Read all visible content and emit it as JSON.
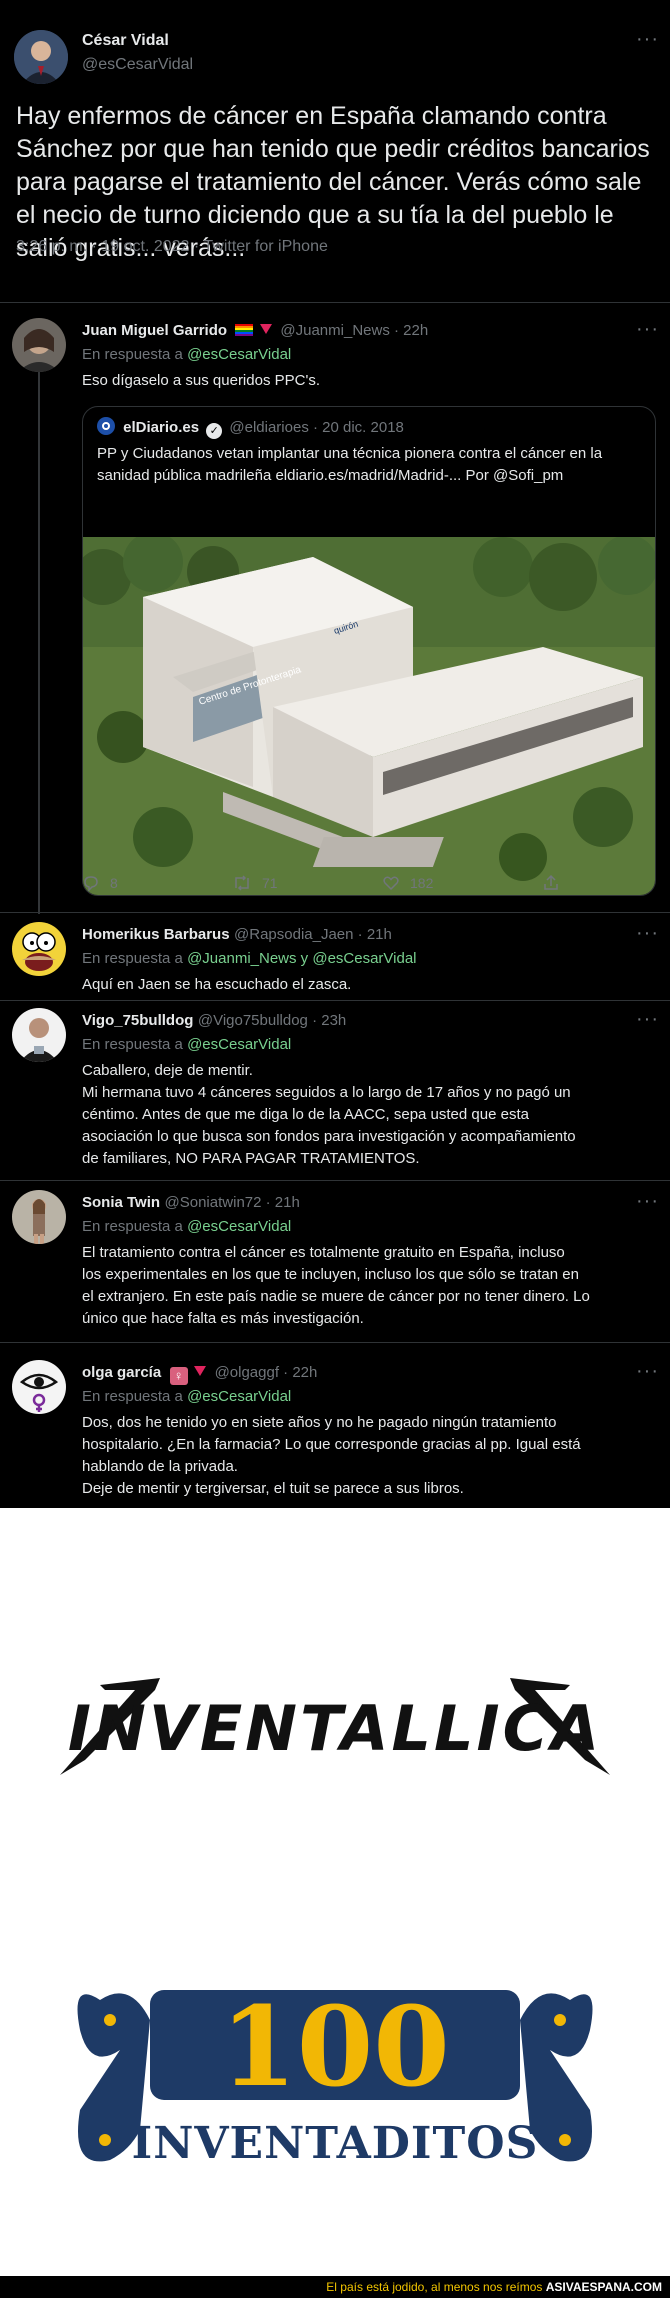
{
  "main_tweet": {
    "name": "César Vidal",
    "handle": "@esCesarVidal",
    "text": "Hay enfermos de cáncer en España clamando contra Sánchez por que han tenido que pedir créditos bancarios para pagarse el tratamiento del cáncer. Verás cómo sale el necio de turno diciendo que a su tía la del pueblo le salió gratis... verás...",
    "meta": "3:26 p. m. · 19 oct. 2022 · Twitter for iPhone"
  },
  "replies": [
    {
      "name": "Juan Miguel Garrido",
      "handle": "@Juanmi_News · 22h",
      "replying_prefix": "En respuesta a",
      "replying_to": "@esCesarVidal",
      "text": "Eso dígaselo a sus queridos PPC's.",
      "quote": {
        "author": "elDiario.es",
        "author_handle": "@eldiarioes · 20 dic. 2018",
        "text": "PP y Ciudadanos vetan implantar una técnica pionera contra el cáncer en la sanidad pública madrileña eldiario.es/madrid/Madrid-... Por @Sofi_pm",
        "image_sign_left": "Centro de Protonterapia",
        "image_sign_right": "quirón"
      },
      "actions": {
        "replies": "8",
        "retweets": "71",
        "likes": "182"
      }
    },
    {
      "name": "Homerikus Barbarus",
      "handle": "@Rapsodia_Jaen · 21h",
      "replying_prefix": "En respuesta a",
      "replying_to": "@Juanmi_News y @esCesarVidal",
      "text": "Aquí en Jaen se ha escuchado el zasca."
    },
    {
      "name": "Vigo_75bulldog",
      "handle": "@Vigo75bulldog · 23h",
      "replying_prefix": "En respuesta a",
      "replying_to": "@esCesarVidal",
      "lines": [
        "Caballero, deje de mentir.",
        "Mi hermana tuvo 4 cánceres seguidos a lo largo de 17 años y no pagó un",
        "céntimo. Antes de que me diga lo de la AACC, sepa usted que esta",
        "asociación lo que busca son fondos para investigación y acompañamiento",
        "de familiares, NO PARA PAGAR TRATAMIENTOS."
      ]
    },
    {
      "name": "Sonia Twin",
      "handle": "@Soniatwin72 · 21h",
      "replying_prefix": "En respuesta a",
      "replying_to": "@esCesarVidal",
      "lines": [
        "El tratamiento contra el cáncer es totalmente gratuito en España, incluso",
        "los experimentales en los que te incluyen, incluso los que sólo se tratan en",
        "el extranjero. En este país nadie se muere de cáncer por no tener dinero. Lo",
        "único que hace falta es más investigación."
      ]
    },
    {
      "name": "olga garcía",
      "handle": "@olgaggf · 22h",
      "replying_prefix": "En respuesta a",
      "replying_to": "@esCesarVidal",
      "lines": [
        "Dos, dos he tenido yo en siete años y no he pagado ningún tratamiento",
        "hospitalario. ¿En la  farmacia? Lo que corresponde gracias al pp. Igual está",
        "hablando de la privada.",
        "Deje de mentir y tergiversar, el tuit se parece a sus libros."
      ]
    }
  ],
  "logos": {
    "first": "INVENTALLICA",
    "second_number": "100",
    "second_word": "INVENTADITOS"
  },
  "footer": {
    "tagline": "El país está jodido, al menos nos reímos",
    "site": "ASIVAESPANA.COM"
  },
  "colors": {
    "background": "#000000",
    "text": "#e7e9ea",
    "muted": "#71767b",
    "mention": "#79d08f",
    "footer_yellow": "#f2c500",
    "logo_blue": "#1e3a66",
    "logo_yellow": "#f2b705"
  }
}
